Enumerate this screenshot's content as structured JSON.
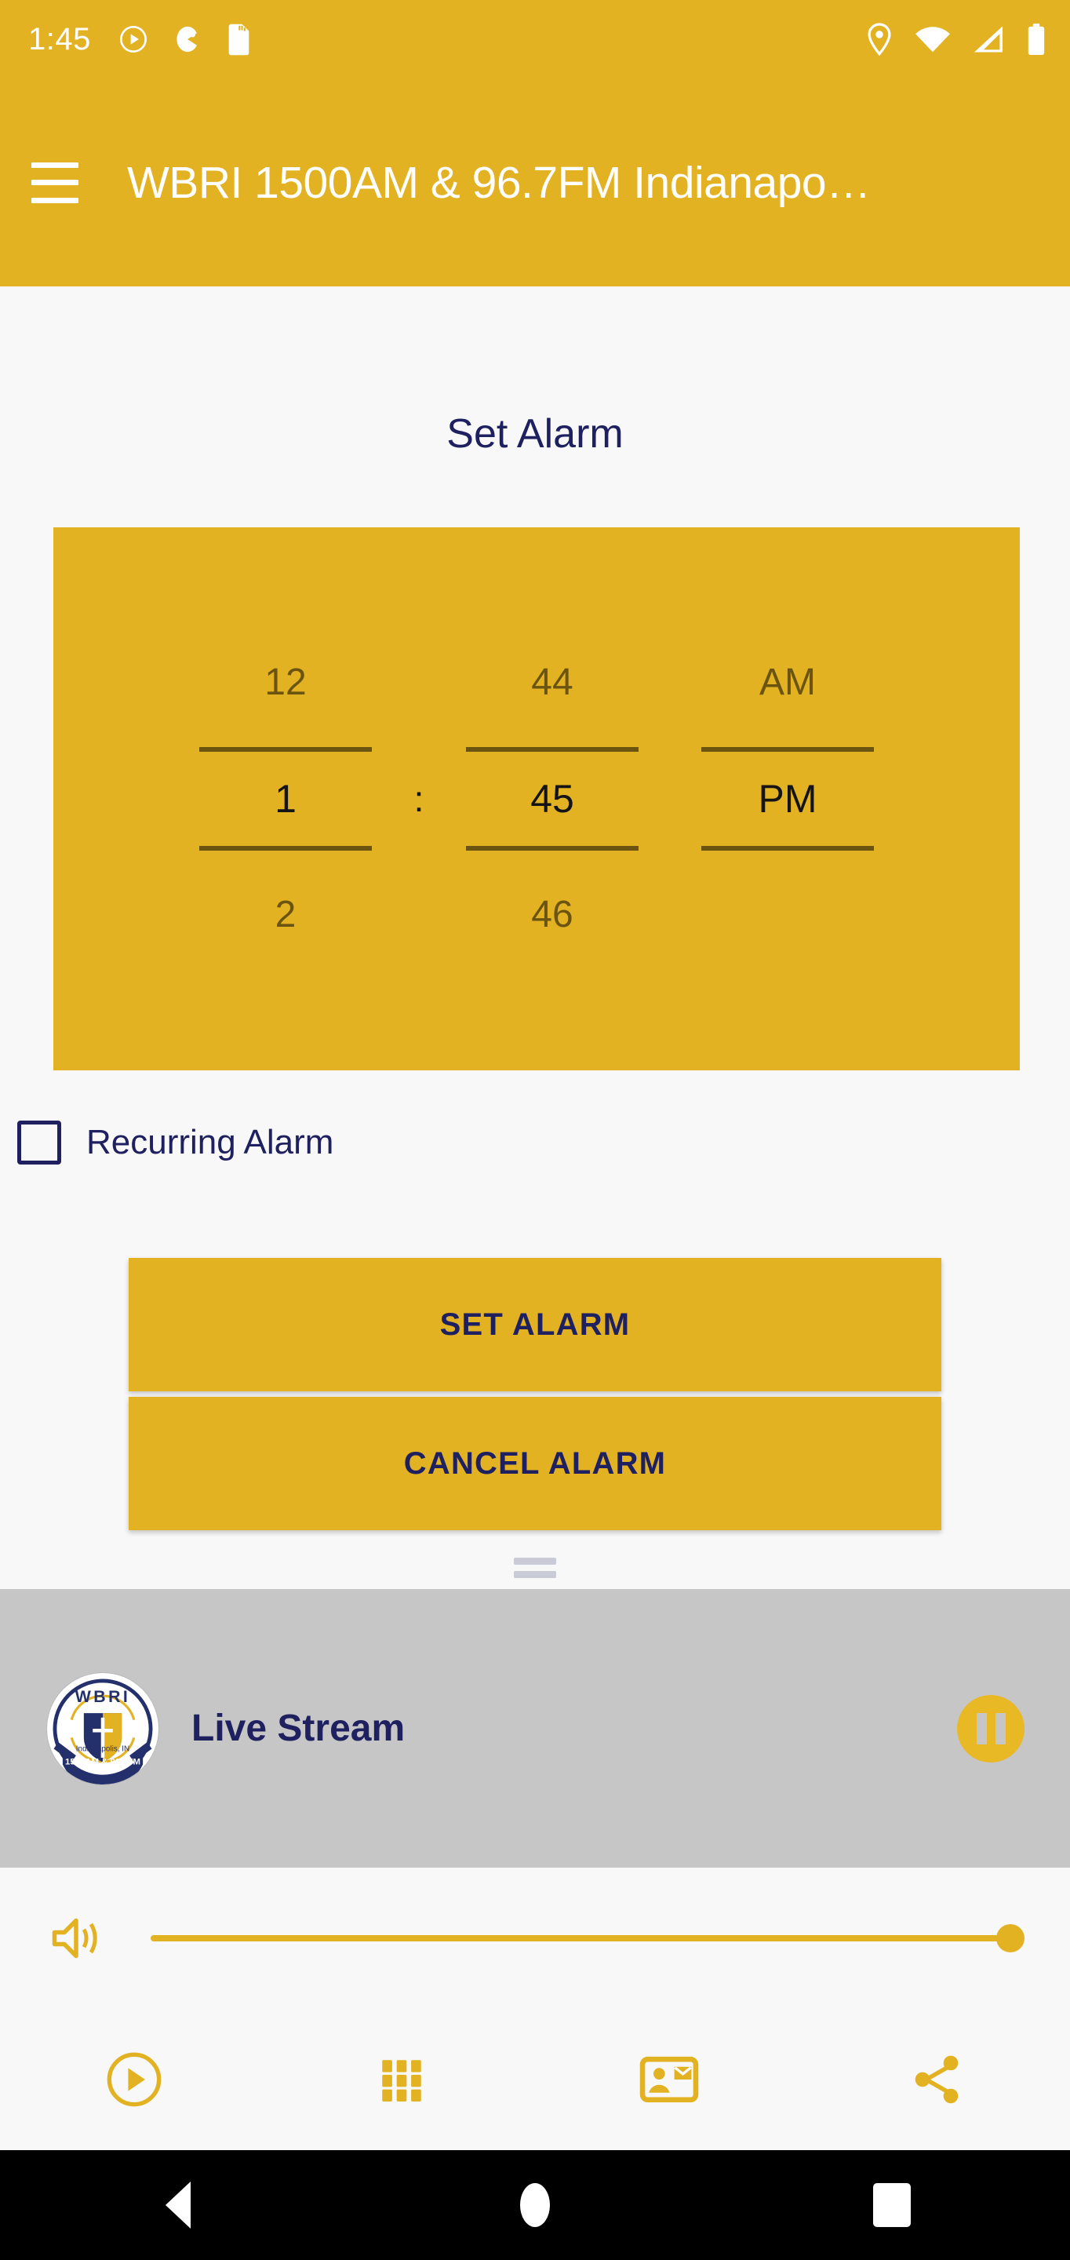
{
  "status_bar": {
    "time": "1:45",
    "left_icons": [
      "play-circle-icon",
      "pacman-icon",
      "sd-card-icon"
    ],
    "right_icons": [
      "location-pin-icon",
      "wifi-icon",
      "cell-signal-icon",
      "battery-icon"
    ]
  },
  "app_bar": {
    "menu_icon": "hamburger-menu-icon",
    "title": "WBRI 1500AM & 96.7FM Indianapo…"
  },
  "main": {
    "section_title": "Set Alarm",
    "time_picker": {
      "hours": {
        "previous": "12",
        "selected": "1",
        "next": "2"
      },
      "separator": ":",
      "minutes": {
        "previous": "44",
        "selected": "45",
        "next": "46"
      },
      "meridiem": {
        "previous": "AM",
        "selected": "PM",
        "next": ""
      }
    },
    "recurring_alarm": {
      "label": "Recurring Alarm",
      "checked": false
    },
    "set_alarm_button": "SET ALARM",
    "cancel_alarm_button": "CANCEL ALARM"
  },
  "player": {
    "logo_alt": "WBRI Indianapolis 1500AM & 96.7FM",
    "logo_text": {
      "call_sign": "WBRI",
      "city": "Indianapolis, IN",
      "frequency": "1500AM & 96.7FM"
    },
    "title": "Live Stream",
    "transport_button": "pause-icon",
    "volume": {
      "icon": "volume-up-icon",
      "level_percent": 100
    }
  },
  "bottom_nav": {
    "items": [
      {
        "name": "player",
        "icon": "play-circle-icon"
      },
      {
        "name": "apps-grid",
        "icon": "grid-apps-icon"
      },
      {
        "name": "contact",
        "icon": "contact-card-icon"
      },
      {
        "name": "share",
        "icon": "share-icon"
      }
    ]
  },
  "android_nav": {
    "back": "back-triangle-icon",
    "home": "home-circle-icon",
    "recents": "recents-square-icon"
  },
  "colors": {
    "accent_yellow": "#E2B223",
    "navy": "#1E2060",
    "page_background": "#F8F8F8",
    "player_background": "#C6C6C6",
    "picker_dim_text": "#6B5410"
  }
}
